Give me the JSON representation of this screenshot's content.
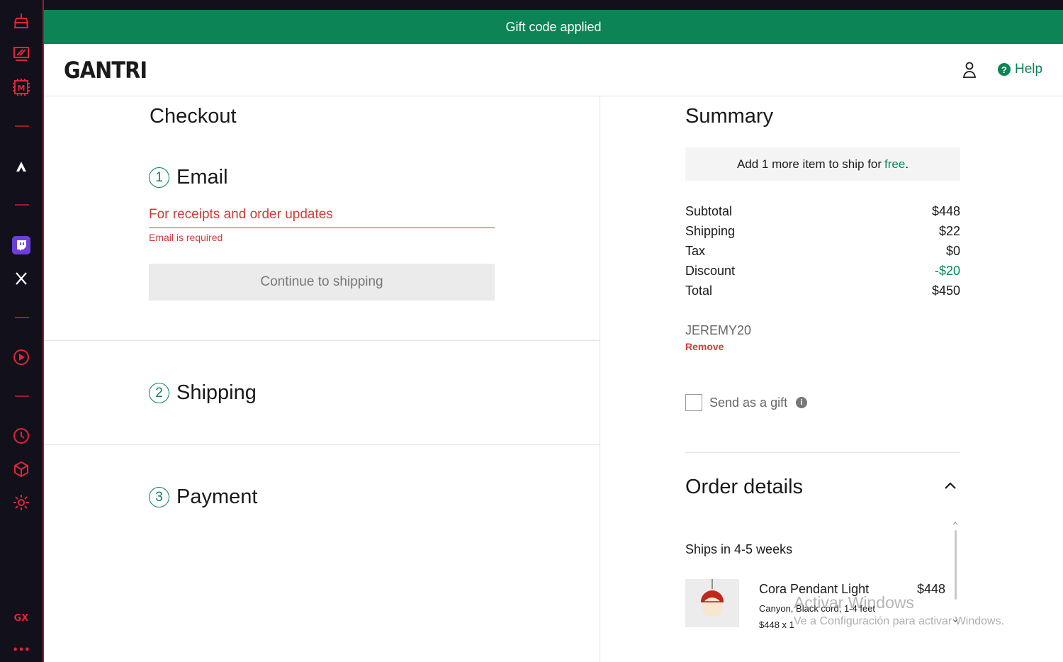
{
  "browser_sidebar": {
    "icons": [
      "cleaner-icon",
      "gx-control-icon",
      "gx-corner-icon",
      "aria-icon",
      "twitch-icon",
      "x-twitter-icon",
      "player-icon",
      "history-icon",
      "extensions-icon",
      "settings-icon",
      "more-icon"
    ],
    "gx_label": "GX",
    "more_label": "•••"
  },
  "banner": {
    "text": "Gift code applied"
  },
  "header": {
    "logo": "GANTRI",
    "account_icon": "user-icon",
    "help_label": "Help",
    "help_icon": "question-icon"
  },
  "checkout": {
    "title": "Checkout",
    "email_step": {
      "number": "1",
      "title": "Email",
      "placeholder": "For receipts and order updates",
      "value": "",
      "error": "Email is required",
      "button": "Continue to shipping"
    },
    "shipping_step": {
      "number": "2",
      "title": "Shipping"
    },
    "payment_step": {
      "number": "3",
      "title": "Payment"
    }
  },
  "summary": {
    "title": "Summary",
    "ship_note": {
      "prefix": "Add 1 more item to ship for",
      "free": "free",
      "suffix": "."
    },
    "rows": [
      {
        "label": "Subtotal",
        "value": "$448"
      },
      {
        "label": "Shipping",
        "value": "$22"
      },
      {
        "label": "Tax",
        "value": "$0"
      },
      {
        "label": "Discount",
        "value": "-$20"
      },
      {
        "label": "Total",
        "value": "$450"
      }
    ],
    "promo_code": "JEREMY20",
    "remove_label": "Remove",
    "gift_label": "Send as a gift",
    "gift_checked": false
  },
  "order_details": {
    "title": "Order details",
    "ships_in": "Ships in 4-5 weeks",
    "item": {
      "name": "Cora Pendant Light",
      "price": "$448",
      "variant": "Canyon, Black cord, 1-4 feet",
      "qty": "$448 x 1"
    }
  },
  "watermark": {
    "title": "Activar Windows",
    "subtitle": "Ve a Configuración para activar Windows."
  },
  "colors": {
    "brand_green": "#0c8456",
    "error_red": "#d43a3a",
    "gx_red": "#e0243a",
    "sidebar_bg": "#12101a"
  }
}
